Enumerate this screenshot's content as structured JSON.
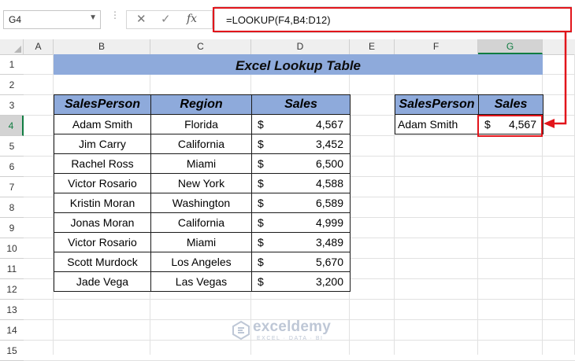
{
  "name_box": {
    "value": "G4"
  },
  "formula_bar": {
    "formula": "=LOOKUP(F4,B4:D12)",
    "fx_label": "fx"
  },
  "columns": [
    "A",
    "B",
    "C",
    "D",
    "E",
    "F",
    "G"
  ],
  "active_column": "G",
  "rows": [
    "1",
    "2",
    "3",
    "4",
    "5",
    "6",
    "7",
    "8",
    "9",
    "10",
    "11",
    "12",
    "13",
    "14",
    "15"
  ],
  "active_row": "4",
  "title": "Excel Lookup Table",
  "main_table": {
    "headers": [
      "SalesPerson",
      "Region",
      "Sales"
    ],
    "currency_symbol": "$",
    "rows": [
      {
        "salesperson": "Adam Smith",
        "region": "Florida",
        "sales": "4,567"
      },
      {
        "salesperson": "Jim Carry",
        "region": "California",
        "sales": "3,452"
      },
      {
        "salesperson": "Rachel Ross",
        "region": "Miami",
        "sales": "6,500"
      },
      {
        "salesperson": "Victor Rosario",
        "region": "New York",
        "sales": "4,588"
      },
      {
        "salesperson": "Kristin Moran",
        "region": "Washington",
        "sales": "6,589"
      },
      {
        "salesperson": "Jonas Moran",
        "region": "California",
        "sales": "4,999"
      },
      {
        "salesperson": "Victor Rosario",
        "region": "Miami",
        "sales": "3,489"
      },
      {
        "salesperson": "Scott Murdock",
        "region": "Los Angeles",
        "sales": "5,670"
      },
      {
        "salesperson": "Jade Vega",
        "region": "Las Vegas",
        "sales": "3,200"
      }
    ]
  },
  "lookup_table": {
    "headers": [
      "SalesPerson",
      "Sales"
    ],
    "salesperson": "Adam Smith",
    "currency_symbol": "$",
    "sales": "4,567"
  },
  "colors": {
    "header_fill": "#8eaadb",
    "highlight": "#e2151b",
    "excel_green": "#107c41"
  },
  "watermark": {
    "name": "exceldemy",
    "tagline": "EXCEL · DATA · BI"
  }
}
